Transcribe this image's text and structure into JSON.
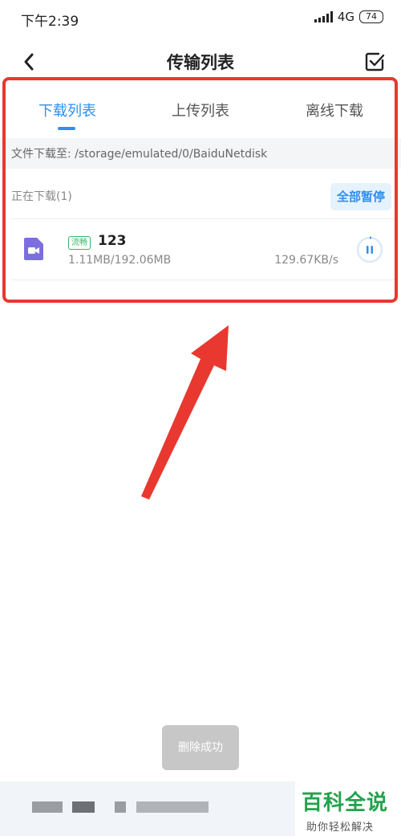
{
  "status_bar": {
    "time": "下午2:39",
    "network": "4G",
    "battery": "74"
  },
  "header": {
    "title": "传输列表"
  },
  "tabs": [
    {
      "label": "下载列表",
      "active": true
    },
    {
      "label": "上传列表",
      "active": false
    },
    {
      "label": "离线下载",
      "active": false
    }
  ],
  "download_path": {
    "text": "文件下载至: /storage/emulated/0/BaiduNetdisk"
  },
  "section": {
    "label": "正在下载(1)",
    "pause_all_label": "全部暂停"
  },
  "downloads": [
    {
      "badge": "流畅",
      "name": "123",
      "size": "1.11MB/192.06MB",
      "speed": "129.67KB/s"
    }
  ],
  "toast": {
    "text": "删除成功"
  },
  "watermark": {
    "title": "百科全说",
    "subtitle": "助你轻松解决"
  },
  "colors": {
    "accent": "#2f8ff0",
    "highlight": "#e8382f",
    "file_icon": "#7b6fe0",
    "watermark": "#23a24d"
  }
}
